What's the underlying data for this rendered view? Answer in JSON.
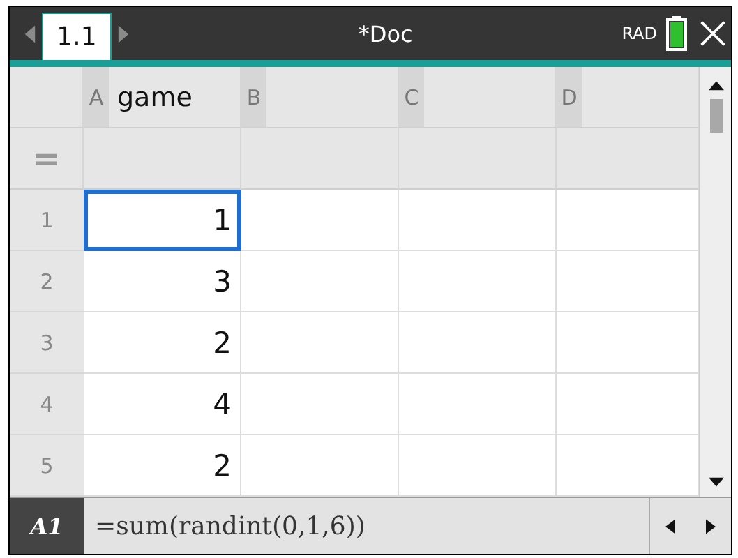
{
  "window": {
    "title": "*Doc",
    "mode": "RAD"
  },
  "tabs": [
    {
      "label": "1.1",
      "selected": true
    }
  ],
  "columns": [
    {
      "letter": "A",
      "name": "game"
    },
    {
      "letter": "B"
    },
    {
      "letter": "C"
    },
    {
      "letter": "D"
    }
  ],
  "formula_row": {
    "label": "="
  },
  "rows": [
    {
      "number": "1",
      "cells": [
        {
          "value": "1",
          "selected": true
        }
      ]
    },
    {
      "number": "2",
      "cells": [
        {
          "value": "3",
          "selected": false
        }
      ]
    },
    {
      "number": "3",
      "cells": [
        {
          "value": "2",
          "selected": false
        }
      ]
    },
    {
      "number": "4",
      "cells": [
        {
          "value": "4",
          "selected": false
        }
      ]
    },
    {
      "number": "5",
      "cells": [
        {
          "value": "2",
          "selected": false
        }
      ]
    }
  ],
  "entry_line": {
    "cell": "A1",
    "formula": "=sum(randint(0,1,6))"
  }
}
